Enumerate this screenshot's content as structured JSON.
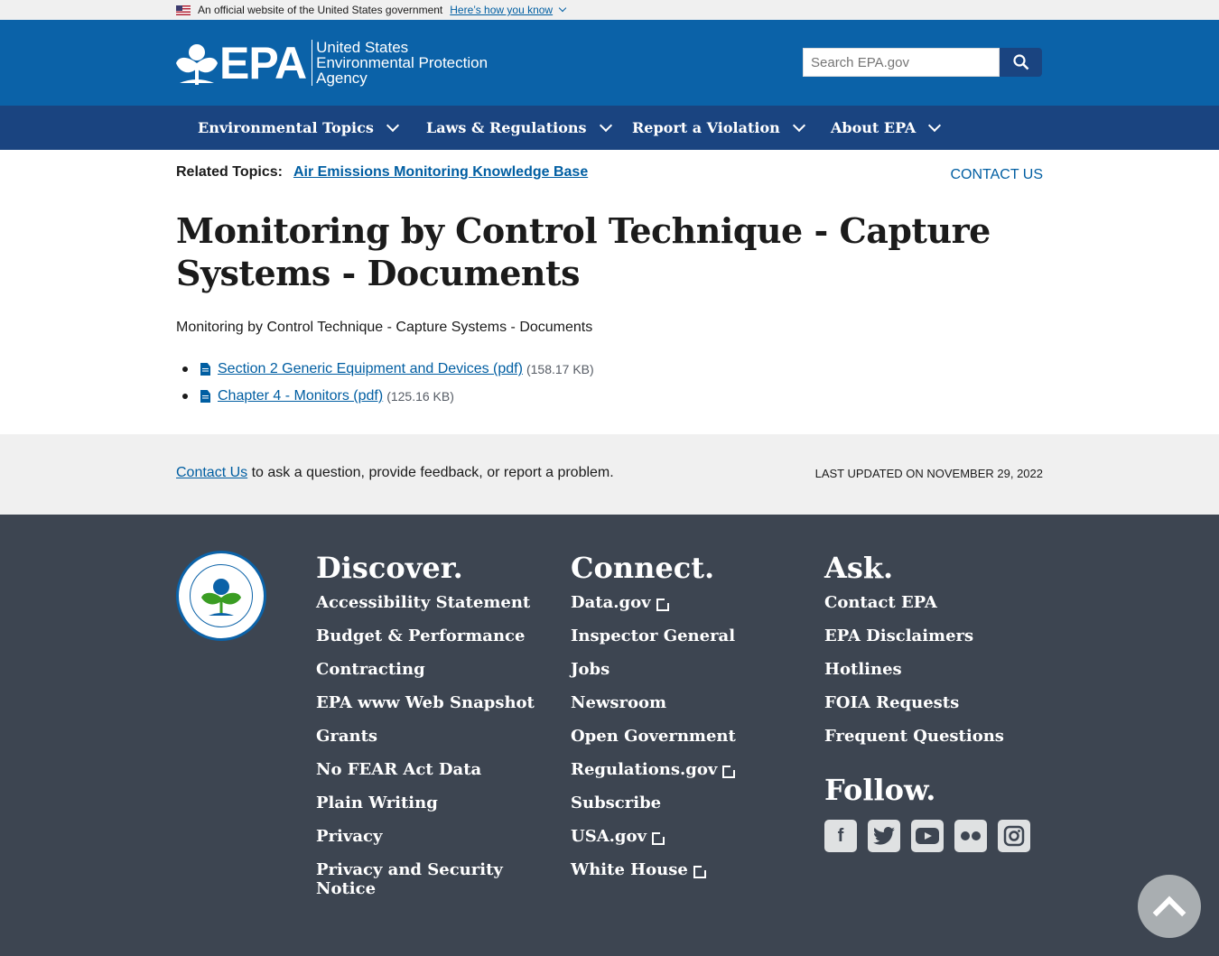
{
  "gov_banner": {
    "text": "An official website of the United States government",
    "link": "Here’s how you know"
  },
  "header": {
    "logo_letters": "EPA",
    "logo_line1": "United States",
    "logo_line2": "Environmental Protection",
    "logo_line3": "Agency",
    "search_placeholder": "Search EPA.gov"
  },
  "nav": {
    "items": [
      {
        "label": "Environmental Topics"
      },
      {
        "label": "Laws & Regulations"
      },
      {
        "label": "Report a Violation"
      },
      {
        "label": "About EPA"
      }
    ]
  },
  "main": {
    "related_label": "Related Topics:",
    "related_link": "Air Emissions Monitoring Knowledge Base",
    "contact_us": "CONTACT US",
    "title": "Monitoring by Control Technique - Capture Systems - Documents",
    "intro": "Monitoring by Control Technique - Capture Systems - Documents",
    "documents": [
      {
        "label": "Section 2 Generic Equipment and Devices (pdf)",
        "size": "(158.17 KB)"
      },
      {
        "label": "Chapter 4 - Monitors (pdf)",
        "size": "(125.16 KB)"
      }
    ]
  },
  "feedback": {
    "link": "Contact Us",
    "text": " to ask a question, provide feedback, or report a problem.",
    "updated": "LAST UPDATED ON NOVEMBER 29, 2022"
  },
  "footer": {
    "discover": {
      "heading": "Discover.",
      "links": [
        "Accessibility Statement",
        "Budget & Performance",
        "Contracting",
        "EPA www Web Snapshot",
        "Grants",
        "No FEAR Act Data",
        "Plain Writing",
        "Privacy",
        "Privacy and Security Notice"
      ]
    },
    "connect": {
      "heading": "Connect.",
      "links": [
        "Data.gov",
        "Inspector General",
        "Jobs",
        "Newsroom",
        "Open Government",
        "Regulations.gov",
        "Subscribe",
        "USA.gov",
        "White House"
      ]
    },
    "ask": {
      "heading": "Ask.",
      "links": [
        "Contact EPA",
        "EPA Disclaimers",
        "Hotlines",
        "FOIA Requests",
        "Frequent Questions"
      ]
    },
    "follow": {
      "heading": "Follow.",
      "icons": [
        "facebook-icon",
        "twitter-icon",
        "youtube-icon",
        "flickr-icon",
        "instagram-icon"
      ]
    }
  },
  "colors": {
    "header": "#0b62a8",
    "nav": "#1a4480",
    "footer": "#3d4551",
    "link": "#005ea2"
  }
}
